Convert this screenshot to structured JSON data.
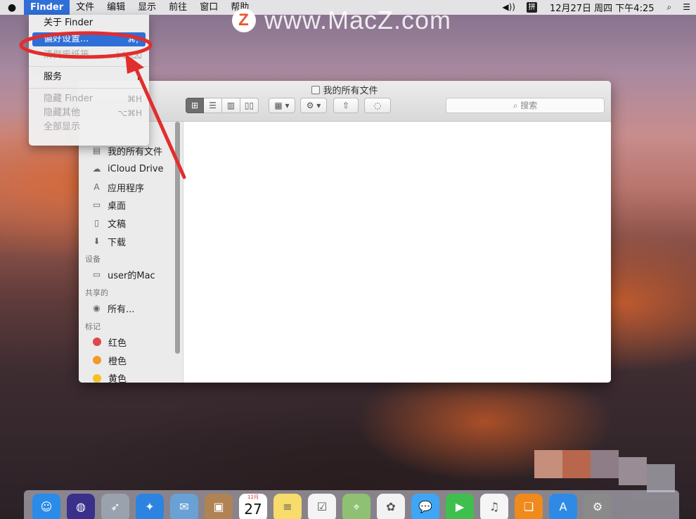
{
  "menubar": {
    "active_app": "Finder",
    "menus": [
      "文件",
      "编辑",
      "显示",
      "前往",
      "窗口",
      "帮助"
    ],
    "ime_indicator": "拼",
    "clock": "12月27日 周四 下午4:25"
  },
  "watermark": {
    "logo_letter": "Z",
    "text": "www.MacZ.com"
  },
  "finder_menu": {
    "about": "关于 Finder",
    "preferences": "偏好设置...",
    "preferences_shortcut": "⌘,",
    "empty_trash": "清倒废纸篓...",
    "empty_trash_shortcut": "⇧⌘⌫",
    "services": "服务",
    "hide_finder": "隐藏 Finder",
    "hide_finder_shortcut": "⌘H",
    "hide_others": "隐藏其他",
    "hide_others_shortcut": "⌥⌘H",
    "show_all": "全部显示"
  },
  "window": {
    "title": "我的所有文件",
    "search_placeholder": "搜索"
  },
  "sidebar": {
    "favorites": [
      {
        "label": "我的所有文件",
        "icon": "all-files-icon",
        "glyph": "▤"
      },
      {
        "label": "iCloud Drive",
        "icon": "cloud-icon",
        "glyph": "☁"
      },
      {
        "label": "应用程序",
        "icon": "applications-icon",
        "glyph": "A"
      },
      {
        "label": "桌面",
        "icon": "desktop-icon",
        "glyph": "▭"
      },
      {
        "label": "文稿",
        "icon": "documents-icon",
        "glyph": "▯"
      },
      {
        "label": "下载",
        "icon": "downloads-icon",
        "glyph": "⬇"
      }
    ],
    "devices_header": "设备",
    "devices": [
      {
        "label": "user的Mac",
        "icon": "computer-icon",
        "glyph": "▭"
      }
    ],
    "shared_header": "共享的",
    "shared": [
      {
        "label": "所有...",
        "icon": "network-icon",
        "glyph": "◉"
      }
    ],
    "tags_header": "标记",
    "tags": [
      {
        "label": "红色",
        "color": "#e0464b"
      },
      {
        "label": "橙色",
        "color": "#f19a2b"
      },
      {
        "label": "黄色",
        "color": "#f2c224"
      }
    ]
  },
  "dock": {
    "calendar_month": "12月",
    "calendar_day": "27",
    "apps": [
      {
        "name": "finder-dock-icon",
        "color": "#2b8be8",
        "glyph": "☺"
      },
      {
        "name": "siri-dock-icon",
        "color": "#3a2f8a",
        "glyph": "◍"
      },
      {
        "name": "launchpad-dock-icon",
        "color": "#9aa3ad",
        "glyph": "➶"
      },
      {
        "name": "safari-dock-icon",
        "color": "#2d83e0",
        "glyph": "✦"
      },
      {
        "name": "mail-dock-icon",
        "color": "#6aa1d4",
        "glyph": "✉"
      },
      {
        "name": "contacts-dock-icon",
        "color": "#b08355",
        "glyph": "▣"
      },
      {
        "name": "calendar-dock-icon",
        "color": "#ffffff",
        "glyph": ""
      },
      {
        "name": "notes-dock-icon",
        "color": "#f7dc6b",
        "glyph": "≡"
      },
      {
        "name": "reminders-dock-icon",
        "color": "#f4f4f4",
        "glyph": "☑"
      },
      {
        "name": "maps-dock-icon",
        "color": "#8fc175",
        "glyph": "⌖"
      },
      {
        "name": "photos-dock-icon",
        "color": "#f2f2f2",
        "glyph": "✿"
      },
      {
        "name": "messages-dock-icon",
        "color": "#3ea6f5",
        "glyph": "💬"
      },
      {
        "name": "facetime-dock-icon",
        "color": "#3fbf4d",
        "glyph": "▶"
      },
      {
        "name": "itunes-dock-icon",
        "color": "#f5f5f5",
        "glyph": "♫"
      },
      {
        "name": "ibooks-dock-icon",
        "color": "#f08a1d",
        "glyph": "❏"
      },
      {
        "name": "appstore-dock-icon",
        "color": "#2f8ae6",
        "glyph": "A"
      },
      {
        "name": "system-prefs-dock-icon",
        "color": "#8a8a8a",
        "glyph": "⚙"
      }
    ]
  }
}
